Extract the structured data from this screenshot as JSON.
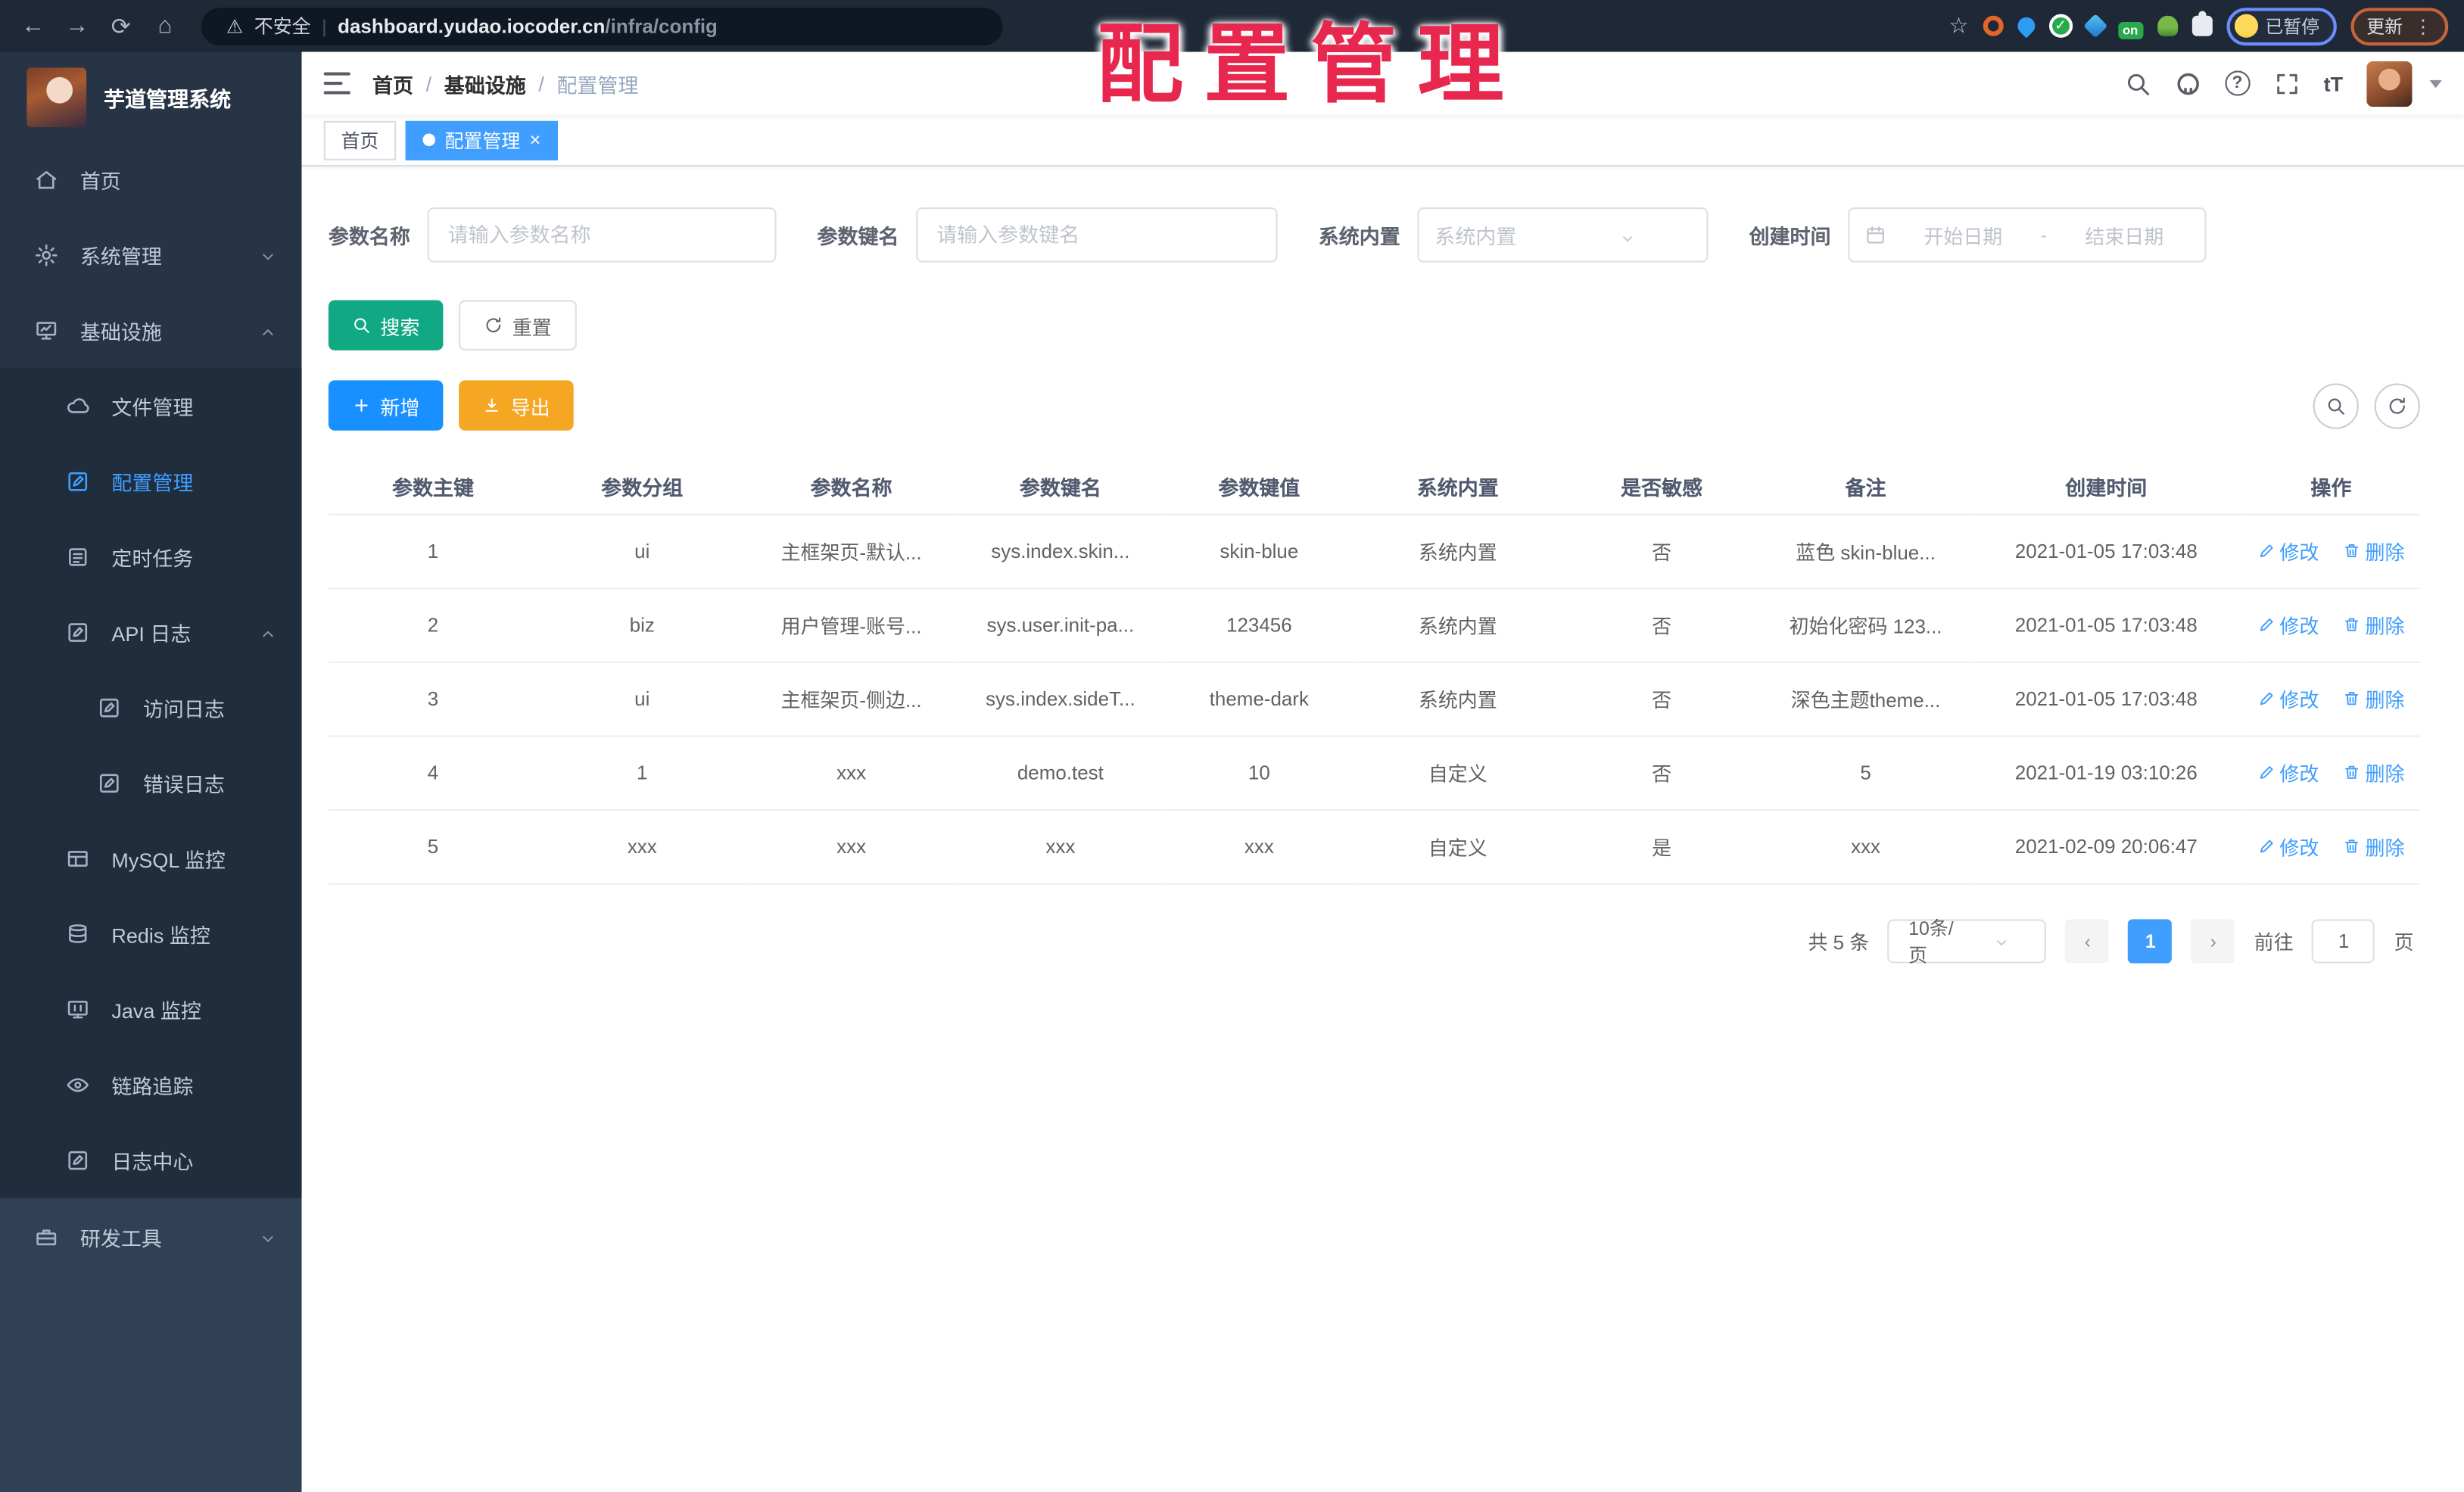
{
  "colors": {
    "accent": "#409EFF",
    "search_button": "#11A983",
    "add_button": "#1890ff",
    "export_button": "#F5A623",
    "watermark": "#e8274e",
    "sidebar_bg": "#304156",
    "submenu_bg": "#1f2d3d"
  },
  "watermark_text": "配置管理",
  "browser": {
    "security_label": "不安全",
    "host": "dashboard.yudao.iocoder.cn",
    "path": "/infra/config",
    "on_badge": "on",
    "paused_label": "已暂停",
    "update_label": "更新"
  },
  "glyphs": {
    "back": "←",
    "forward": "→",
    "reload": "⟳",
    "home": "⌂",
    "warning": "⚠",
    "divider": "|",
    "star": "☆",
    "check": "✓",
    "dots": "⋮",
    "question": "?",
    "font_size": "tT",
    "close": "×",
    "breadcrumb_sep": "/",
    "prev": "‹",
    "next": "›"
  },
  "sidebar": {
    "title": "芋道管理系统",
    "items": [
      {
        "label": "首页"
      },
      {
        "label": "系统管理"
      },
      {
        "label": "基础设施"
      },
      {
        "label": "文件管理"
      },
      {
        "label": "配置管理"
      },
      {
        "label": "定时任务"
      },
      {
        "label": "API 日志"
      },
      {
        "label": "访问日志"
      },
      {
        "label": "错误日志"
      },
      {
        "label": "MySQL 监控"
      },
      {
        "label": "Redis 监控"
      },
      {
        "label": "Java 监控"
      },
      {
        "label": "链路追踪"
      },
      {
        "label": "日志中心"
      },
      {
        "label": "研发工具"
      }
    ]
  },
  "breadcrumb": [
    "首页",
    "基础设施",
    "配置管理"
  ],
  "tabs": [
    {
      "label": "首页"
    },
    {
      "label": "配置管理"
    }
  ],
  "filters": {
    "name_label": "参数名称",
    "name_placeholder": "请输入参数名称",
    "key_label": "参数键名",
    "key_placeholder": "请输入参数键名",
    "type_label": "系统内置",
    "type_placeholder": "系统内置",
    "date_label": "创建时间",
    "date_start": "开始日期",
    "date_sep": "-",
    "date_end": "结束日期",
    "search_label": "搜索",
    "reset_label": "重置"
  },
  "toolbar": {
    "add_label": "新增",
    "export_label": "导出"
  },
  "table": {
    "headers": [
      "参数主键",
      "参数分组",
      "参数名称",
      "参数键名",
      "参数键值",
      "系统内置",
      "是否敏感",
      "备注",
      "创建时间",
      "操作"
    ],
    "edit_label": "修改",
    "delete_label": "删除",
    "rows": [
      {
        "id": "1",
        "group": "ui",
        "name": "主框架页-默认...",
        "key": "sys.index.skin...",
        "value": "skin-blue",
        "type": "系统内置",
        "sensitive": "否",
        "remark": "蓝色 skin-blue...",
        "created": "2021-01-05 17:03:48"
      },
      {
        "id": "2",
        "group": "biz",
        "name": "用户管理-账号...",
        "key": "sys.user.init-pa...",
        "value": "123456",
        "type": "系统内置",
        "sensitive": "否",
        "remark": "初始化密码 123...",
        "created": "2021-01-05 17:03:48"
      },
      {
        "id": "3",
        "group": "ui",
        "name": "主框架页-侧边...",
        "key": "sys.index.sideT...",
        "value": "theme-dark",
        "type": "系统内置",
        "sensitive": "否",
        "remark": "深色主题theme...",
        "created": "2021-01-05 17:03:48"
      },
      {
        "id": "4",
        "group": "1",
        "name": "xxx",
        "key": "demo.test",
        "value": "10",
        "type": "自定义",
        "sensitive": "否",
        "remark": "5",
        "created": "2021-01-19 03:10:26"
      },
      {
        "id": "5",
        "group": "xxx",
        "name": "xxx",
        "key": "xxx",
        "value": "xxx",
        "type": "自定义",
        "sensitive": "是",
        "remark": "xxx",
        "created": "2021-02-09 20:06:47"
      }
    ]
  },
  "pagination": {
    "total_label": "共 5 条",
    "page_size_label": "10条/页",
    "current_page": "1",
    "goto_label": "前往",
    "goto_value": "1",
    "page_unit_label": "页"
  }
}
